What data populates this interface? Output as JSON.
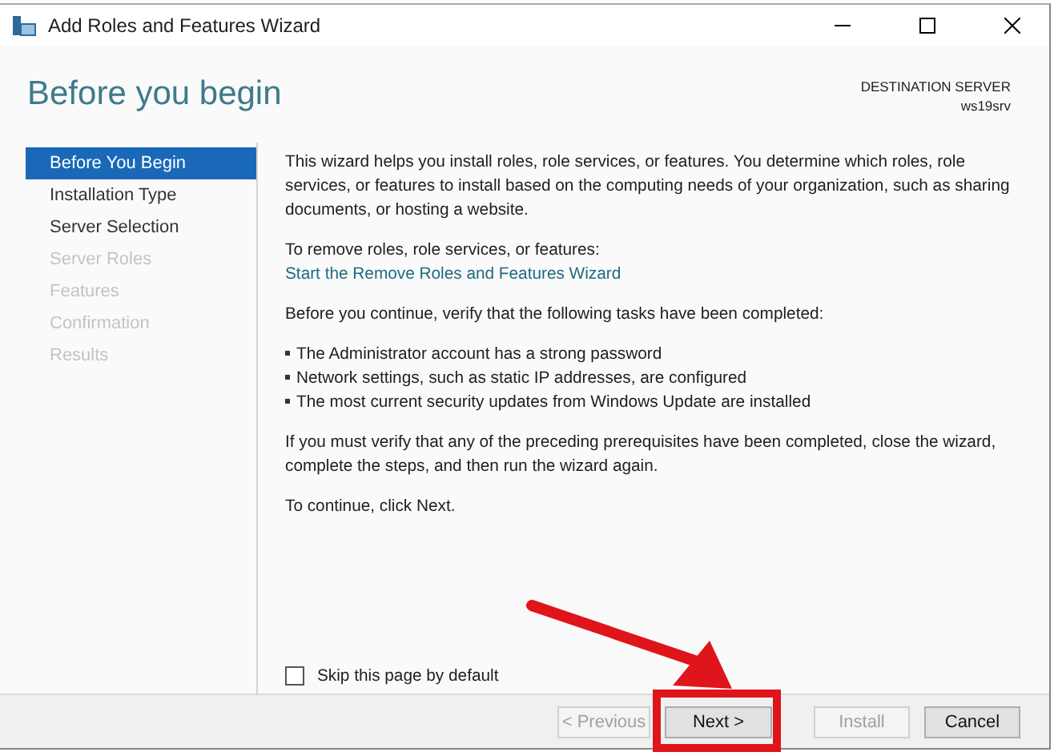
{
  "window": {
    "title": "Add Roles and Features Wizard"
  },
  "header": {
    "title": "Before you begin",
    "destination_label": "DESTINATION SERVER",
    "destination_server": "ws19srv"
  },
  "sidebar": {
    "items": [
      {
        "label": "Before You Begin",
        "selected": true,
        "disabled": false
      },
      {
        "label": "Installation Type",
        "selected": false,
        "disabled": false
      },
      {
        "label": "Server Selection",
        "selected": false,
        "disabled": false
      },
      {
        "label": "Server Roles",
        "selected": false,
        "disabled": true
      },
      {
        "label": "Features",
        "selected": false,
        "disabled": true
      },
      {
        "label": "Confirmation",
        "selected": false,
        "disabled": true
      },
      {
        "label": "Results",
        "selected": false,
        "disabled": true
      }
    ]
  },
  "content": {
    "intro": "This wizard helps you install roles, role services, or features. You determine which roles, role services, or features to install based on the computing needs of your organization, such as sharing documents, or hosting a website.",
    "remove_label": "To remove roles, role services, or features:",
    "remove_link": "Start the Remove Roles and Features Wizard",
    "verify_text": "Before you continue, verify that the following tasks have been completed:",
    "tasks": [
      "The Administrator account has a strong password",
      "Network settings, such as static IP addresses, are configured",
      "The most current security updates from Windows Update are installed"
    ],
    "prereq_text": "If you must verify that any of the preceding prerequisites have been completed, close the wizard, complete the steps, and then run the wizard again.",
    "continue_text": "To continue, click Next."
  },
  "skip_checkbox": {
    "label": "Skip this page by default",
    "checked": false
  },
  "buttons": [
    {
      "label": "< Previous",
      "disabled": true
    },
    {
      "label": "Next >",
      "disabled": false
    },
    {
      "label": "Install",
      "disabled": true
    },
    {
      "label": "Cancel",
      "disabled": false
    }
  ]
}
